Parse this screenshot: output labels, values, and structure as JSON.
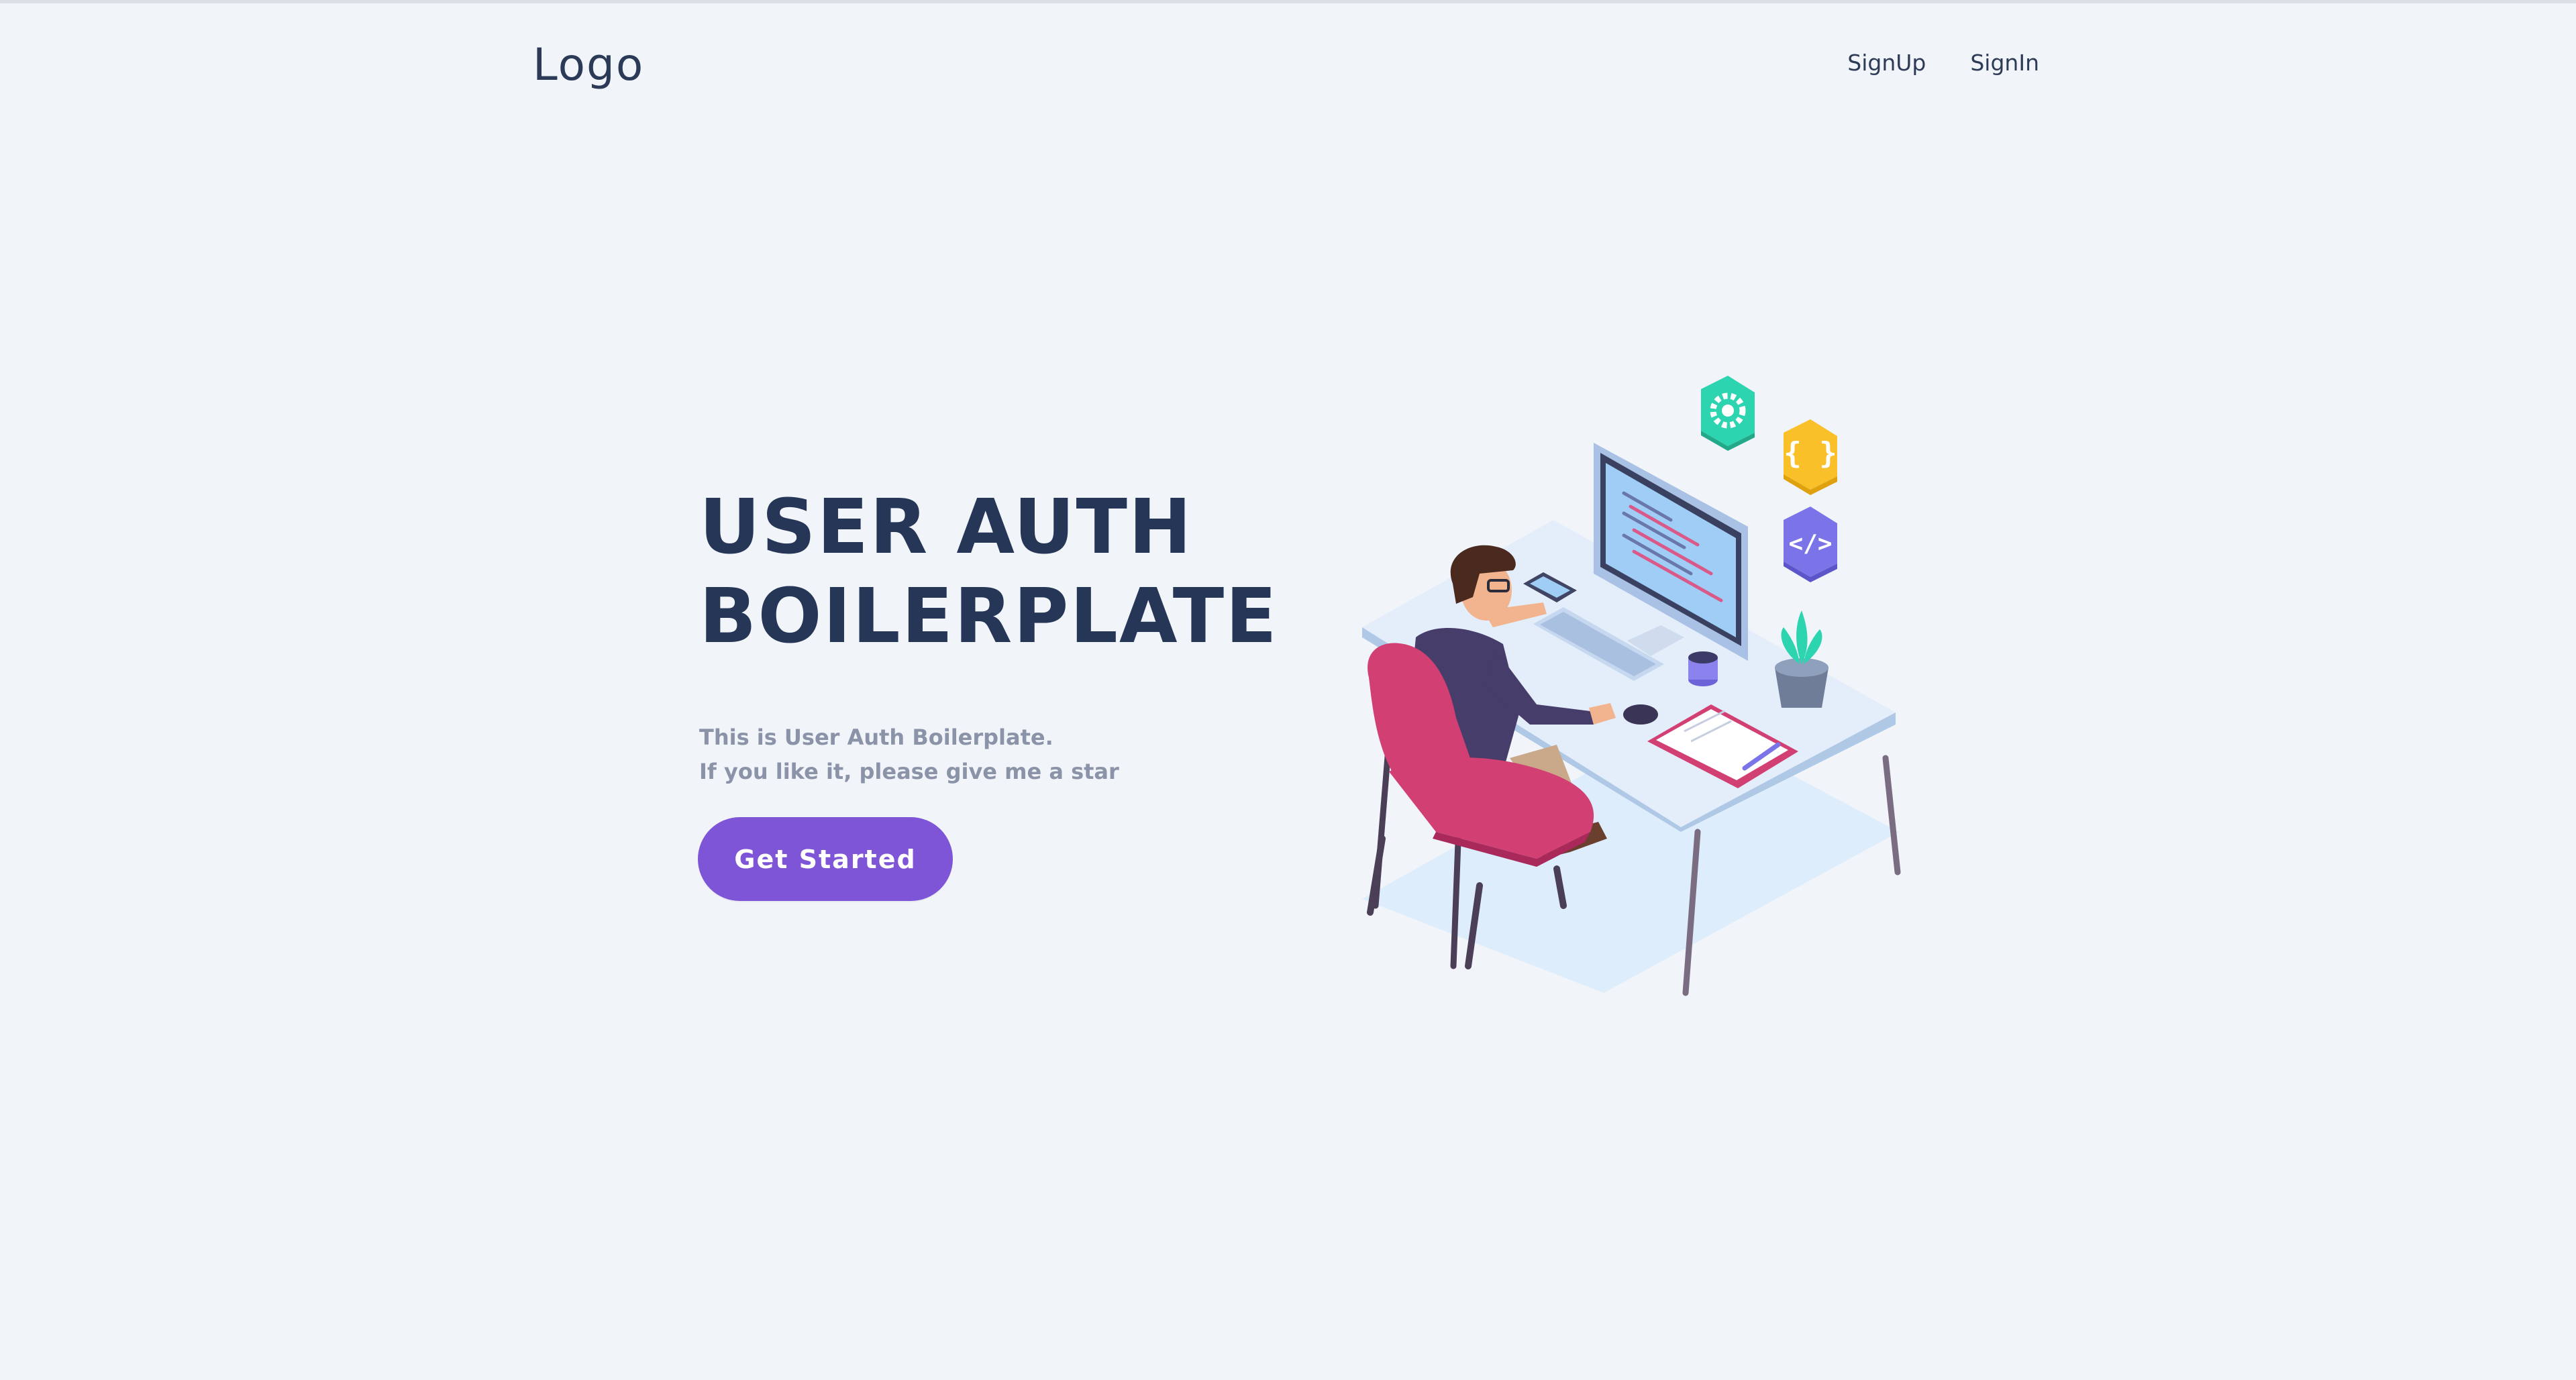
{
  "header": {
    "logo": "Logo",
    "nav": {
      "signup": "SignUp",
      "signin": "SignIn"
    }
  },
  "hero": {
    "title_line1": "USER AUTH",
    "title_line2": "BOILERPLATE",
    "subtitle_line1": "This is User Auth Boilerplate.",
    "subtitle_line2": "If you like it, please give me a star",
    "cta_label": "Get Started"
  },
  "illustration": {
    "description_icon_names": [
      "gear-icon",
      "curly-braces-icon",
      "code-tag-icon",
      "plant-icon",
      "mug-icon"
    ]
  },
  "colors": {
    "background": "#f1f4f9",
    "text_dark": "#263657",
    "text_muted": "#8b93a8",
    "accent": "#7f55d7",
    "chair": "#d23f73",
    "gear_tile": "#2dd4b0",
    "braces_tile": "#f9c02a",
    "code_tile": "#7b74e8"
  }
}
